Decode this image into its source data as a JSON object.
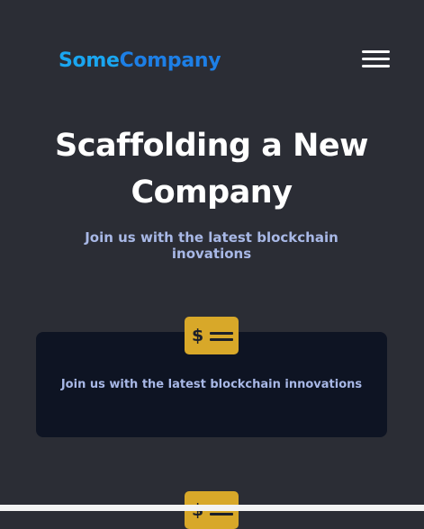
{
  "header": {
    "logo_part1": "Some",
    "logo_part2": "Company",
    "menu_icon": "hamburger-menu-icon"
  },
  "hero": {
    "title": "Scaffolding a New Company",
    "subtitle": "Join us with the latest blockchain inovations"
  },
  "features": [
    {
      "icon": "money-bill-icon",
      "icon_symbol": "$",
      "text": "Join us with the latest blockchain innovations"
    },
    {
      "icon": "money-bill-icon",
      "icon_symbol": "$"
    }
  ],
  "colors": {
    "background": "#2b2d35",
    "card_background": "#0e1423",
    "logo_primary": "#1aa6f0",
    "logo_secondary": "#1d7fe6",
    "accent_yellow": "#d8a829",
    "subtitle_text": "#a8b8e6"
  }
}
